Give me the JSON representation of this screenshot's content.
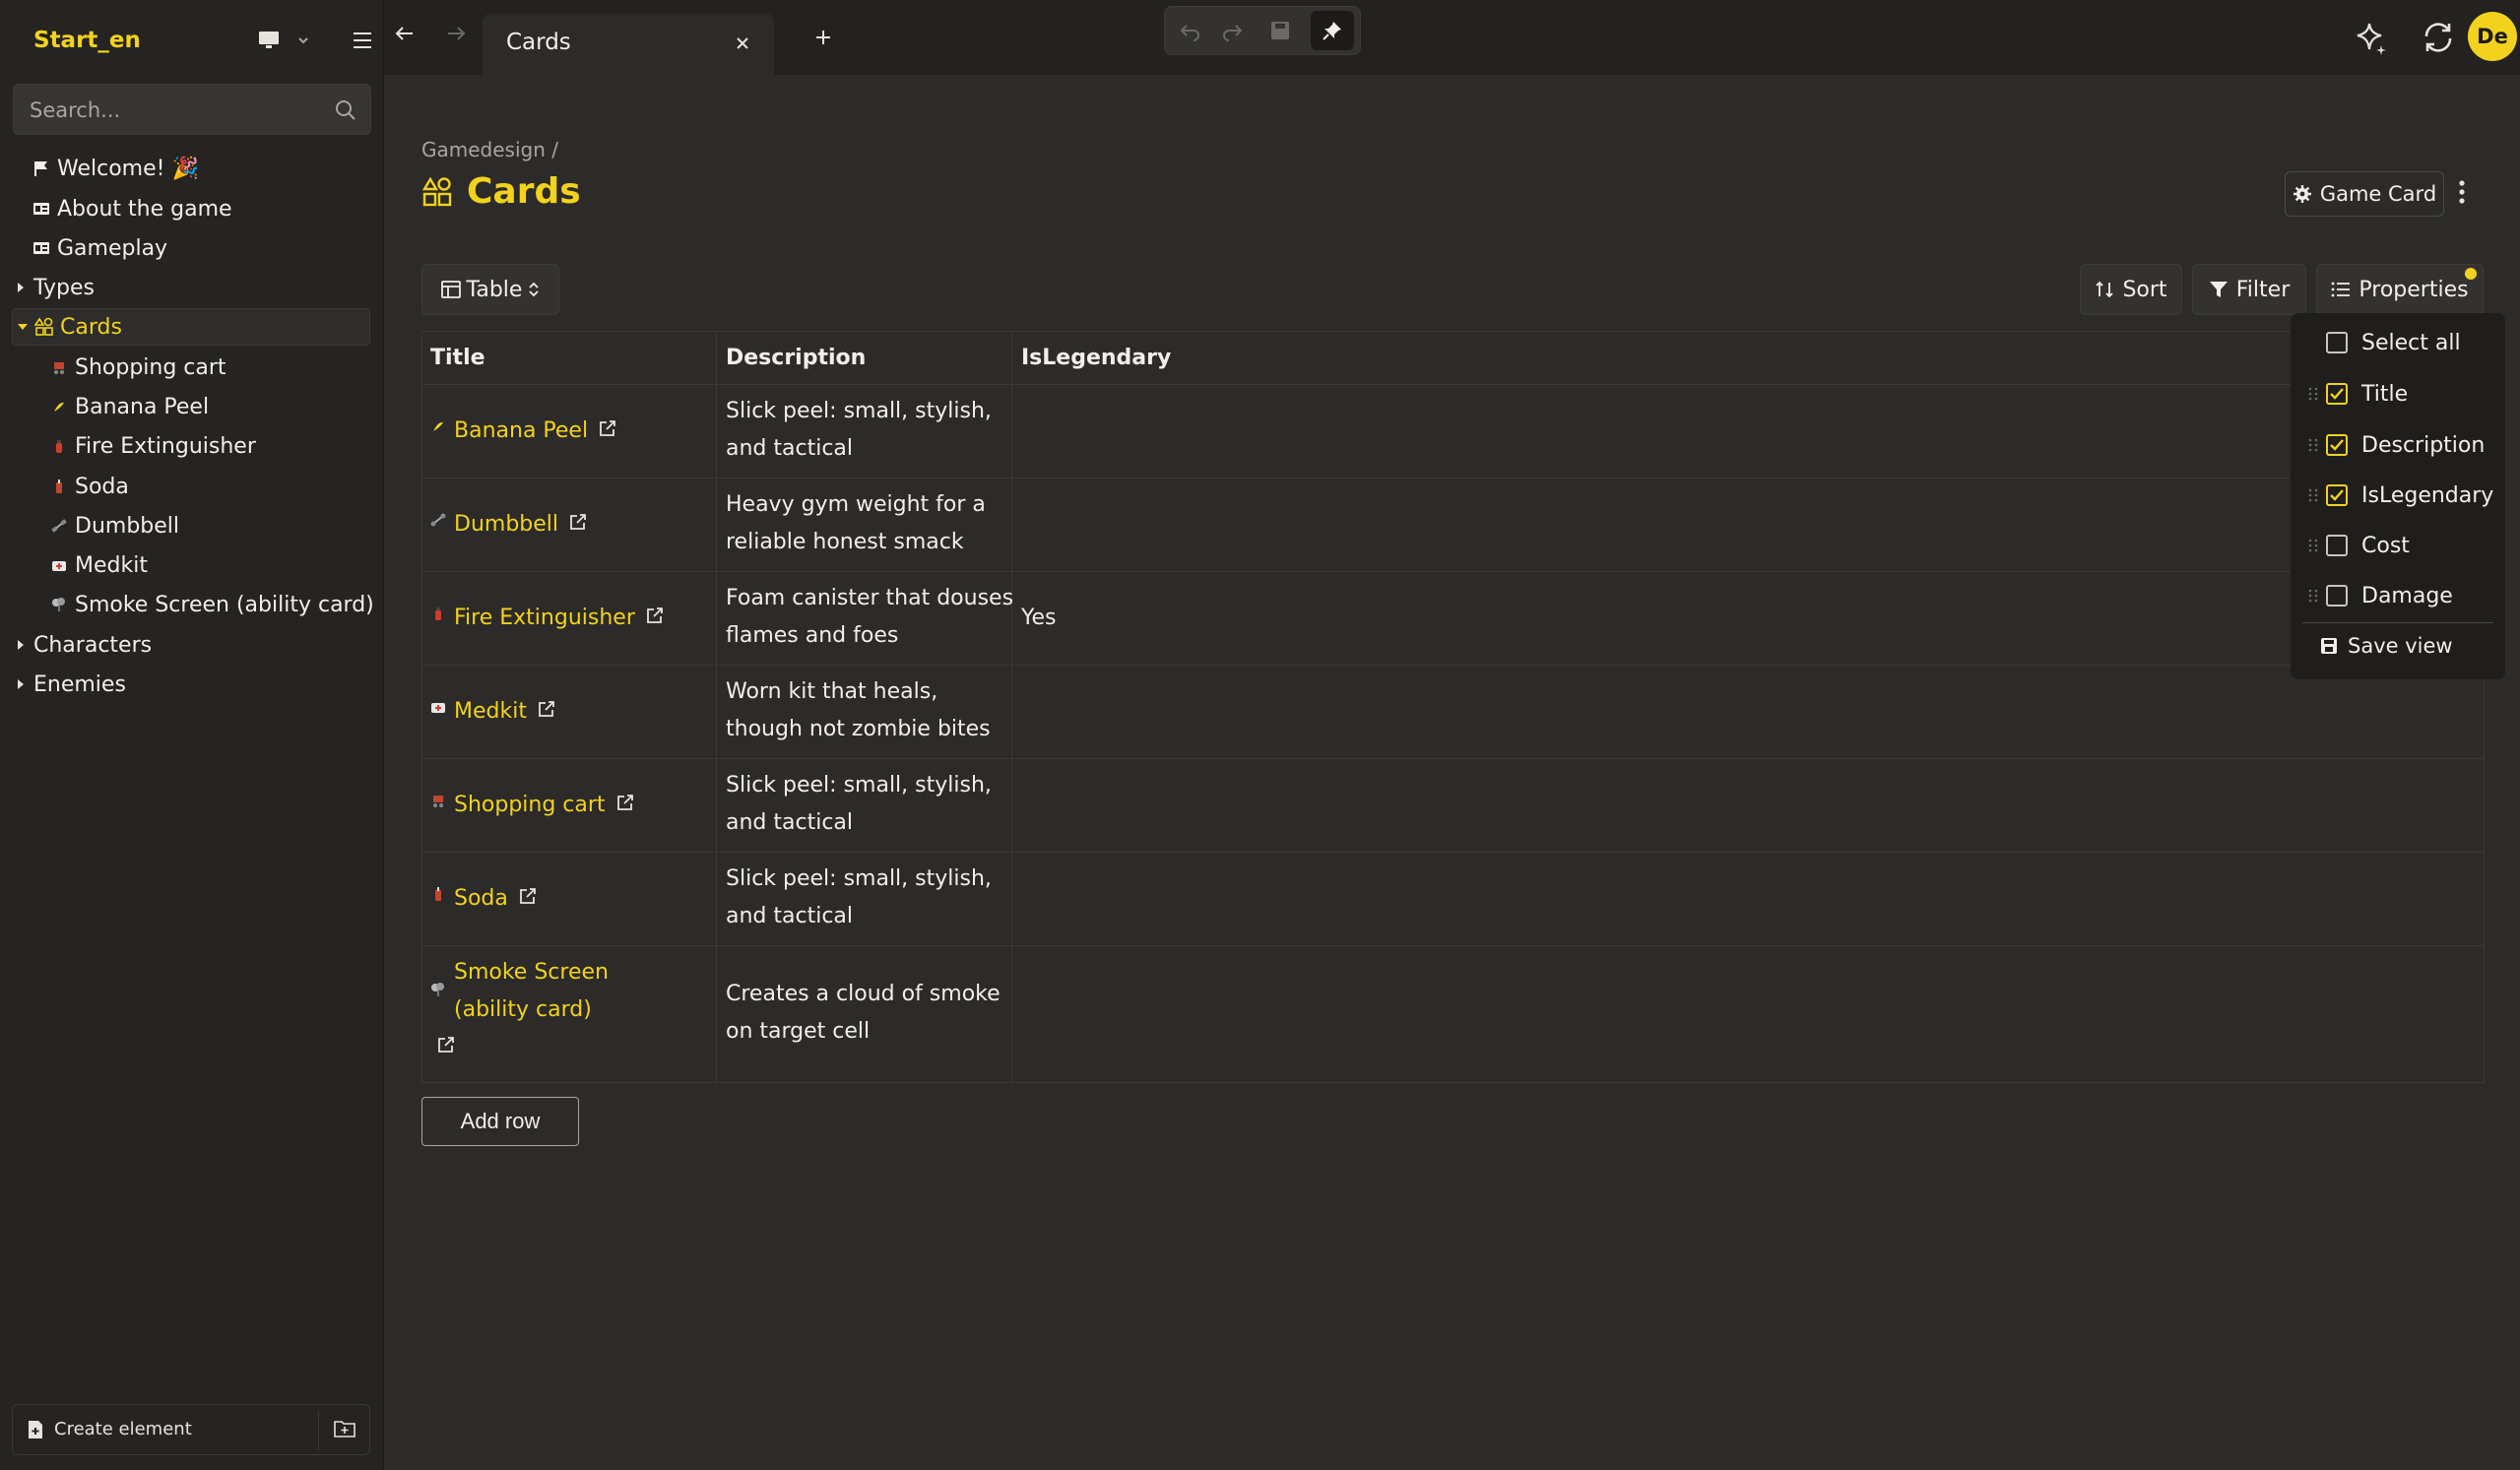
{
  "sidebar": {
    "workspace": "Start_en",
    "search_placeholder": "Search...",
    "tree": [
      {
        "label": "Welcome! 🎉",
        "icon": "flag-icon"
      },
      {
        "label": "About the game",
        "icon": "id-card-icon"
      },
      {
        "label": "Gameplay",
        "icon": "id-card-icon"
      },
      {
        "label": "Types",
        "icon": "caret-right-icon"
      },
      {
        "label": "Cards",
        "icon": "shapes-icon",
        "expanded": true
      },
      {
        "label": "Shopping cart",
        "icon": "shopping-cart-emoji-icon"
      },
      {
        "label": "Banana Peel",
        "icon": "banana-emoji-icon"
      },
      {
        "label": "Fire Extinguisher",
        "icon": "fire-extinguisher-emoji-icon"
      },
      {
        "label": "Soda",
        "icon": "soda-emoji-icon"
      },
      {
        "label": "Dumbbell",
        "icon": "dumbbell-emoji-icon"
      },
      {
        "label": "Medkit",
        "icon": "medkit-emoji-icon"
      },
      {
        "label": "Smoke Screen (ability card)",
        "icon": "smoke-emoji-icon"
      },
      {
        "label": "Characters",
        "icon": "caret-right-icon"
      },
      {
        "label": "Enemies",
        "icon": "caret-right-icon"
      }
    ],
    "create_element": "Create element"
  },
  "tabbar": {
    "tab_title": "Cards"
  },
  "header": {
    "breadcrumb": "Gamedesign /",
    "title": "Cards",
    "game_card_button": "Game Card"
  },
  "toolbar": {
    "view": "Table",
    "sort": "Sort",
    "filter": "Filter",
    "properties": "Properties"
  },
  "table": {
    "columns": [
      "Title",
      "Description",
      "IsLegendary"
    ],
    "rows": [
      {
        "title": "Banana Peel",
        "description": "Slick peel: small, stylish, and tactical",
        "legendary": "",
        "icon": "banana-emoji-icon"
      },
      {
        "title": "Dumbbell",
        "description": "Heavy gym weight for a reliable honest smack",
        "legendary": "",
        "icon": "dumbbell-emoji-icon"
      },
      {
        "title": "Fire Extinguisher",
        "description": "Foam canister that douses flames and foes",
        "legendary": "Yes",
        "icon": "fire-extinguisher-emoji-icon"
      },
      {
        "title": "Medkit",
        "description": "Worn kit that heals, though not zombie bites",
        "legendary": "",
        "icon": "medkit-emoji-icon"
      },
      {
        "title": "Shopping cart",
        "description": "Slick peel: small, stylish, and tactical",
        "legendary": "",
        "icon": "shopping-cart-emoji-icon"
      },
      {
        "title": "Soda",
        "description": "Slick peel: small, stylish, and tactical",
        "legendary": "",
        "icon": "soda-emoji-icon"
      },
      {
        "title": "Smoke Screen (ability card)",
        "description": "Creates a cloud of smoke on target cell",
        "legendary": "",
        "icon": "smoke-emoji-icon"
      }
    ],
    "add_row": "Add row"
  },
  "properties_menu": {
    "select_all": "Select all",
    "items": [
      {
        "label": "Title",
        "checked": true
      },
      {
        "label": "Description",
        "checked": true
      },
      {
        "label": "IsLegendary",
        "checked": true
      },
      {
        "label": "Cost",
        "checked": false
      },
      {
        "label": "Damage",
        "checked": false
      }
    ],
    "save_view": "Save view"
  },
  "user": {
    "avatar_initials": "De"
  },
  "colors": {
    "accent": "#f2d21d",
    "background": "#2c2b29",
    "sidebar": "#252422"
  }
}
